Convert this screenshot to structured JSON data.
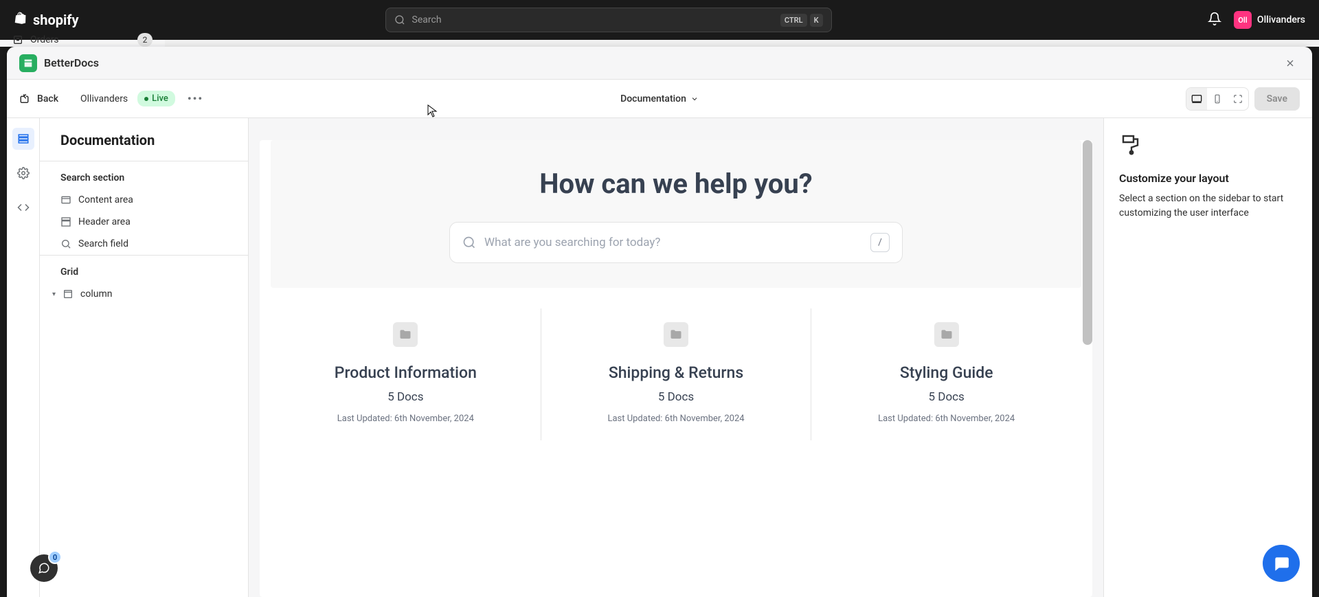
{
  "topbar": {
    "brand": "shopify",
    "search_placeholder": "Search",
    "kbd_ctrl": "CTRL",
    "kbd_k": "K",
    "user_initials": "Oll",
    "user_name": "Ollivanders"
  },
  "admin_peek": {
    "nav_item": "Orders",
    "nav_count": "2"
  },
  "modal": {
    "app_name": "BetterDocs"
  },
  "editor_header": {
    "back": "Back",
    "store": "Ollivanders",
    "status": "Live",
    "page_selector": "Documentation",
    "save": "Save"
  },
  "left_sidebar": {
    "title": "Documentation",
    "section1": "Search section",
    "items1": [
      "Content area",
      "Header area",
      "Search field"
    ],
    "section2": "Grid",
    "items2": [
      "column"
    ]
  },
  "canvas": {
    "hero_title": "How can we help you?",
    "search_placeholder": "What are you searching for today?",
    "slash": "/",
    "cards": [
      {
        "title": "Product Information",
        "docs": "5 Docs",
        "updated": "Last Updated: 6th November, 2024"
      },
      {
        "title": "Shipping & Returns",
        "docs": "5 Docs",
        "updated": "Last Updated: 6th November, 2024"
      },
      {
        "title": "Styling Guide",
        "docs": "5 Docs",
        "updated": "Last Updated: 6th November, 2024"
      }
    ]
  },
  "right_panel": {
    "title": "Customize your layout",
    "text": "Select a section on the sidebar to start customizing the user interface"
  },
  "chat_badge": "0"
}
